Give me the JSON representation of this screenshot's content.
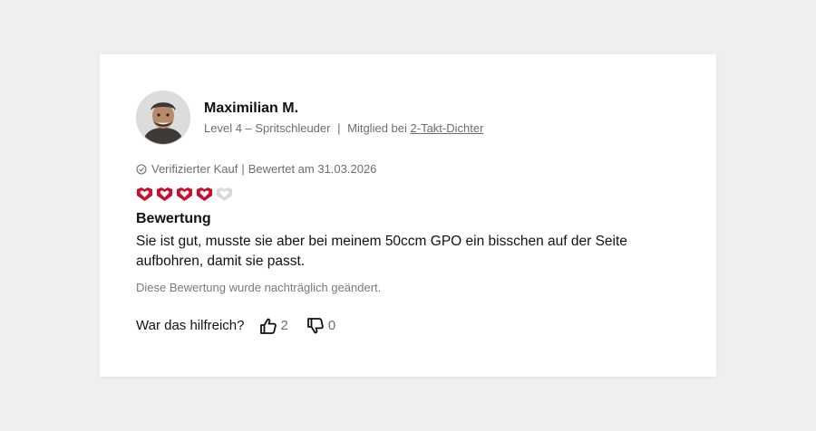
{
  "user": {
    "name": "Maximilian M.",
    "level": "Level 4 – Spritschleuder",
    "separator": "|",
    "member_prefix": "Mitglied bei",
    "member_link": "2-Takt-Dichter"
  },
  "review": {
    "verified": "Verifizierter Kauf",
    "separator": "|",
    "date_label": "Bewertet am 31.03.2026",
    "rating": 4,
    "rating_max": 5,
    "title": "Bewertung",
    "body": "Sie ist gut, musste sie aber bei meinem 50ccm GPO ein bisschen auf der Seite aufbohren, damit sie passt.",
    "edited_note": "Diese Bewertung wurde nachträglich geändert."
  },
  "helpful": {
    "question": "War das hilfreich?",
    "up_count": "2",
    "down_count": "0"
  },
  "colors": {
    "heart_active": "#c8102e",
    "heart_inactive": "#d9d9d9",
    "text_primary": "#111111",
    "text_secondary": "#6d6d6d"
  },
  "icons": {
    "avatar": "user-photo",
    "verified": "check-circle-icon",
    "rating": "heart-badge-icon",
    "vote_up": "thumbs-up-icon",
    "vote_down": "thumbs-down-icon"
  }
}
